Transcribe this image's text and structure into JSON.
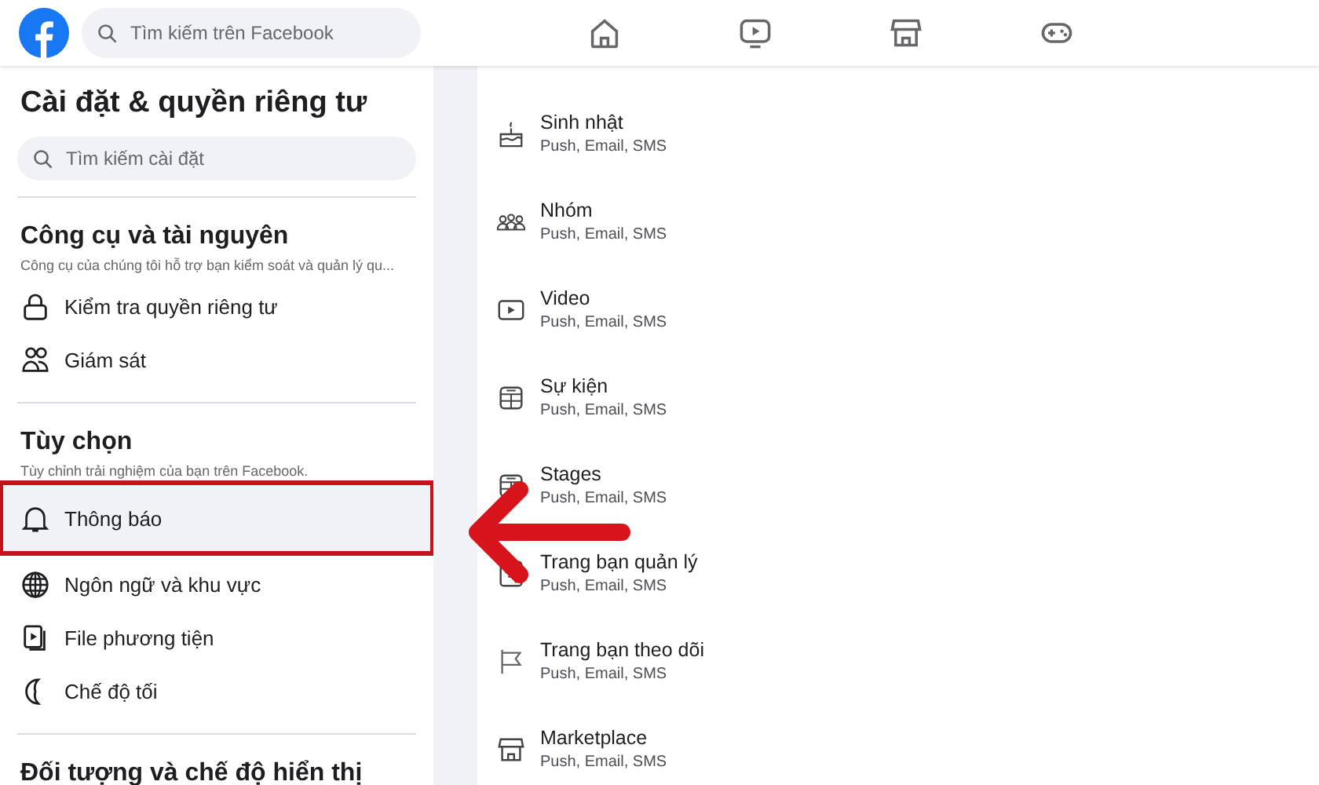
{
  "topbar": {
    "search": {
      "placeholder": "Tìm kiếm trên Facebook"
    },
    "nav": [
      {
        "kind": "home"
      },
      {
        "kind": "video"
      },
      {
        "kind": "store"
      },
      {
        "kind": "game"
      }
    ]
  },
  "sidebar": {
    "title": "Cài đặt & quyền riêng tư",
    "search": {
      "placeholder": "Tìm kiếm cài đặt"
    },
    "sections": [
      {
        "heading": "Công cụ và tài nguyên",
        "description": "Công cụ của chúng tôi hỗ trợ bạn kiểm soát và quản lý qu...",
        "items": [
          {
            "label": "Kiểm tra quyền riêng tư",
            "kind": "lock",
            "selected": false,
            "highlighted": false
          },
          {
            "label": "Giám sát",
            "kind": "people",
            "selected": false,
            "highlighted": false
          }
        ]
      },
      {
        "heading": "Tùy chọn",
        "description": "Tùy chỉnh trải nghiệm của bạn trên Facebook.",
        "items": [
          {
            "label": "Thông báo",
            "kind": "bell",
            "selected": true,
            "highlighted": true
          },
          {
            "label": "Ngôn ngữ và khu vực",
            "kind": "globe",
            "selected": false,
            "highlighted": false
          },
          {
            "label": "File phương tiện",
            "kind": "media",
            "selected": false,
            "highlighted": false
          },
          {
            "label": "Chế độ tối",
            "kind": "moon",
            "selected": false,
            "highlighted": false
          }
        ]
      },
      {
        "heading": "Đối tượng và chế độ hiển thị"
      }
    ]
  },
  "notifications": [
    {
      "title": "Sinh nhật",
      "channels": "Push, Email, SMS",
      "kind": "cake"
    },
    {
      "title": "Nhóm",
      "channels": "Push, Email, SMS",
      "kind": "group"
    },
    {
      "title": "Video",
      "channels": "Push, Email, SMS",
      "kind": "video"
    },
    {
      "title": "Sự kiện",
      "channels": "Push, Email, SMS",
      "kind": "calendar"
    },
    {
      "title": "Stages",
      "channels": "Push, Email, SMS",
      "kind": "calendar"
    },
    {
      "title": "Trang bạn quản lý",
      "channels": "Push, Email, SMS",
      "kind": "page"
    },
    {
      "title": "Trang bạn theo dõi",
      "channels": "Push, Email, SMS",
      "kind": "flag"
    },
    {
      "title": "Marketplace",
      "channels": "Push, Email, SMS",
      "kind": "store"
    }
  ]
}
